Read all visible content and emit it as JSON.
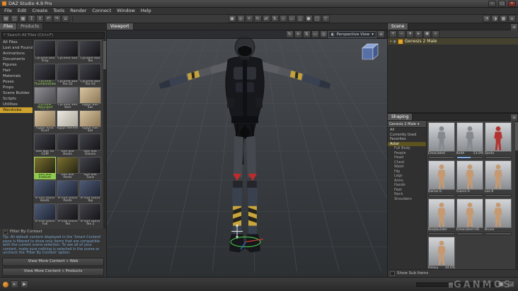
{
  "window": {
    "title": "DAZ Studio 4.9 Pro",
    "minimize": "─",
    "maximize": "□",
    "close": "✕"
  },
  "menu": {
    "items": [
      "File",
      "Edit",
      "Create",
      "Tools",
      "Render",
      "Connect",
      "Window",
      "Help"
    ]
  },
  "toolbar": {
    "left_icons": [
      {
        "glyph": "▤",
        "icon": "new-file-icon"
      },
      {
        "glyph": "▢",
        "icon": "open-file-icon"
      },
      {
        "glyph": "▦",
        "icon": "save-icon"
      },
      {
        "glyph": "↧",
        "icon": "import-icon"
      },
      {
        "glyph": "↥",
        "icon": "export-icon"
      },
      {
        "glyph": "↶",
        "icon": "undo-icon"
      },
      {
        "glyph": "↷",
        "icon": "redo-icon"
      },
      {
        "glyph": "⌂",
        "icon": "home-icon"
      }
    ],
    "center_icons": [
      {
        "glyph": "▣",
        "icon": "node-selection-tool-icon"
      },
      {
        "glyph": "◎",
        "icon": "object-selection-tool-icon"
      },
      {
        "glyph": "+",
        "icon": "universal-tool-icon"
      },
      {
        "glyph": "↻",
        "icon": "rotate-tool-icon"
      },
      {
        "glyph": "⇄",
        "icon": "translate-tool-icon"
      },
      {
        "glyph": "⇅",
        "icon": "scale-tool-icon"
      },
      {
        "glyph": "◇",
        "icon": "active-pose-tool-icon"
      },
      {
        "glyph": "▭",
        "icon": "frame-tool-icon"
      },
      {
        "glyph": "△",
        "icon": "surface-selection-tool-icon"
      },
      {
        "glyph": "●",
        "icon": "spot-render-tool-icon"
      },
      {
        "glyph": "□",
        "icon": "region-navigator-icon"
      },
      {
        "glyph": "▽",
        "icon": "geometry-editor-icon"
      }
    ],
    "right_icons": [
      {
        "glyph": "◔",
        "icon": "render-icon"
      },
      {
        "glyph": "◑",
        "icon": "aux-viewport-icon"
      },
      {
        "glyph": "▦",
        "icon": "layout-icon"
      },
      {
        "glyph": "≡",
        "icon": "preferences-menu-icon"
      }
    ]
  },
  "left": {
    "tabs": [
      {
        "label": "Files",
        "cls": "active"
      },
      {
        "label": "Products"
      }
    ],
    "search": {
      "placeholder": "Search All Files (Ctrl+F)",
      "value": ""
    },
    "categories": [
      {
        "label": "All Files"
      },
      {
        "label": "Lost and Found"
      },
      {
        "label": "Animations"
      },
      {
        "label": "Documents"
      },
      {
        "label": "Figures"
      },
      {
        "label": "Hair"
      },
      {
        "label": "Materials"
      },
      {
        "label": "Poses"
      },
      {
        "label": "Props"
      },
      {
        "label": "Scene Builder"
      },
      {
        "label": "Scripts"
      },
      {
        "label": "Utilities"
      },
      {
        "label": "Wardrobe",
        "cls": "selected"
      }
    ],
    "items": [
      {
        "label": "Cyclone Suit !Iray",
        "cls": "t-dark"
      },
      {
        "label": "Cyclone Suit",
        "cls": "t-dark"
      },
      {
        "label": "Cyclone Suit Tex",
        "cls": "t-dark"
      },
      {
        "label": "Cyclone Thunderstrike",
        "cls": "t-dark green"
      },
      {
        "label": "Cyclone Suit Tex 02",
        "cls": "t-dark"
      },
      {
        "label": "Cyclone Suit Tex 03",
        "cls": "t-dark"
      },
      {
        "label": "Cyclone Wounded Hawk",
        "cls": "t-gray green"
      },
      {
        "label": "Cyclone Suit Vest",
        "cls": "t-gray"
      },
      {
        "label": "Egypt Bull Set",
        "cls": "t-tan"
      },
      {
        "label": "Egypt Khat Scarf",
        "cls": "t-tan"
      },
      {
        "label": "Egypt Nemes",
        "cls": "t-white"
      },
      {
        "label": "Egypt Raif Set",
        "cls": "t-tan"
      },
      {
        "label": "SSS Suit for G2M",
        "cls": "t-dark"
      },
      {
        "label": "SSS Suit Boots",
        "cls": "t-dark"
      },
      {
        "label": "SSS Suit Gloves",
        "cls": "t-dark"
      },
      {
        "label": "SSS Suit Iradium",
        "cls": "t-olive selected"
      },
      {
        "label": "SSS Suit Pants",
        "cls": "t-olive"
      },
      {
        "label": "SSS Suit Tunic",
        "cls": "t-dark"
      },
      {
        "label": "IP Evil Outfit Boots",
        "cls": "t-blue"
      },
      {
        "label": "IP Evil Outfit Pants",
        "cls": "t-blue"
      },
      {
        "label": "IP Evil Outfit Top",
        "cls": "t-blue"
      },
      {
        "label": "IP Evil Outfit Full",
        "cls": "t-blue"
      },
      {
        "label": "IP Evil Outfit Tex",
        "cls": "t-dark"
      },
      {
        "label": "IP Evil Outfit Tex 2",
        "cls": "t-dark"
      }
    ],
    "filter_label": "Filter By Context",
    "filter_checked": "✓",
    "tip": "Tip: All default content displayed in the 'Smart Content' pane is filtered to show only items that are compatible with the current scene selection. To see all of your content, make sure nothing is selected in the scene or uncheck the 'Filter By Context' option.",
    "buttons": {
      "web": "View More Content » Web",
      "products": "View More Content » Products"
    }
  },
  "viewport": {
    "tab": "Viewport",
    "camera": "Perspective View",
    "dropdown_arrow": "▾"
  },
  "scene": {
    "tab": "Scene",
    "node": "Genesis 2 Male",
    "caret": "▾",
    "eye": "◉"
  },
  "shaping": {
    "tab": "Shaping",
    "figure": "Genesis 2 Male",
    "list": [
      {
        "label": "All"
      },
      {
        "label": "Currently Used"
      },
      {
        "label": "Favorites"
      },
      {
        "label": "Actor",
        "cls": "sel"
      },
      {
        "label": "Full Body",
        "cls": "ind"
      },
      {
        "label": "People",
        "cls": "ind"
      },
      {
        "label": "Head",
        "cls": "ind"
      },
      {
        "label": "Chest",
        "cls": "ind"
      },
      {
        "label": "Waist",
        "cls": "ind"
      },
      {
        "label": "Hip",
        "cls": "ind"
      },
      {
        "label": "Legs",
        "cls": "ind"
      },
      {
        "label": "Arms",
        "cls": "ind"
      },
      {
        "label": "Hands",
        "cls": "ind"
      },
      {
        "label": "Feet",
        "cls": "ind"
      },
      {
        "label": "Neck",
        "cls": "ind"
      },
      {
        "label": "Shoulders",
        "cls": "ind"
      }
    ],
    "thumbs": [
      {
        "name": "Emaciated",
        "pct": "",
        "cls": "c-gray"
      },
      {
        "name": "Keith",
        "pct": "53.0%",
        "cls": "c-gray",
        "style": "--pct:53%"
      },
      {
        "name": "Santa",
        "pct": "",
        "cls": "c-red"
      },
      {
        "name": "Darius 6",
        "pct": "",
        "cls": "c-skin"
      },
      {
        "name": "Gianni 6",
        "pct": "",
        "cls": "c-skin"
      },
      {
        "name": "Lee 6",
        "pct": "",
        "cls": "c-skin"
      },
      {
        "name": "Bodybuilder",
        "pct": "",
        "cls": "c-skin"
      },
      {
        "name": "Emaciated HD",
        "pct": "",
        "cls": "c-skin"
      },
      {
        "name": "Bruno",
        "pct": "",
        "cls": "c-skin"
      },
      {
        "name": "Heavy",
        "pct": "34.0%",
        "cls": "c-skin",
        "style": "--pct:34%"
      }
    ],
    "show_sub_items": "Show Sub Items"
  },
  "watermark": "GANMOS",
  "colors": {
    "accent_orange": "#e8a33d",
    "selected_green": "#8fcb4f",
    "category_yellow": "#cda22e"
  }
}
